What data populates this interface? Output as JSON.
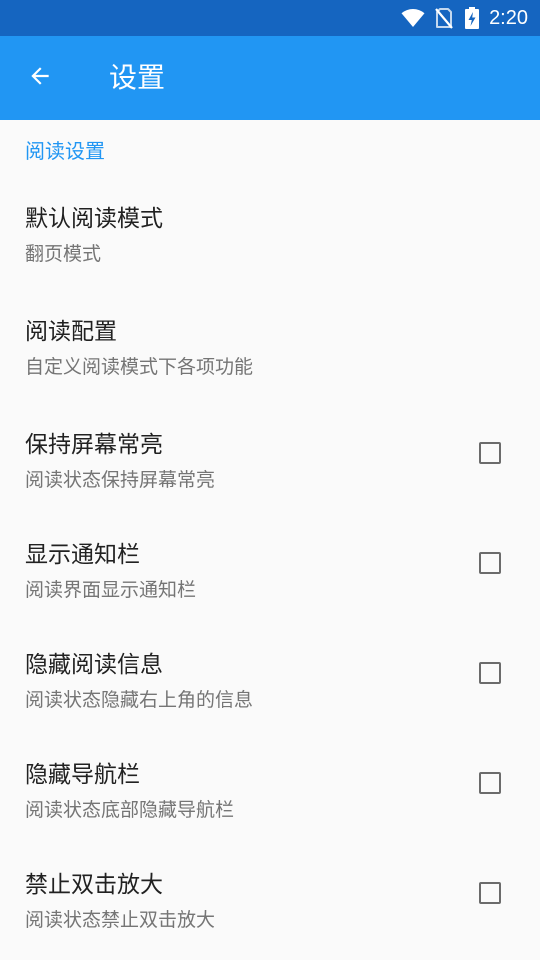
{
  "status_bar": {
    "time": "2:20",
    "icons": [
      "wifi-icon",
      "no-sim-icon",
      "battery-charging-icon"
    ]
  },
  "toolbar": {
    "back_icon": "arrow-left-icon",
    "title": "设置"
  },
  "section": {
    "title": "阅读设置"
  },
  "preferences": [
    {
      "title": "默认阅读模式",
      "summary": "翻页模式",
      "has_checkbox": false
    },
    {
      "title": "阅读配置",
      "summary": "自定义阅读模式下各项功能",
      "has_checkbox": false
    },
    {
      "title": "保持屏幕常亮",
      "summary": "阅读状态保持屏幕常亮",
      "has_checkbox": true,
      "checked": false
    },
    {
      "title": "显示通知栏",
      "summary": "阅读界面显示通知栏",
      "has_checkbox": true,
      "checked": false
    },
    {
      "title": "隐藏阅读信息",
      "summary": "阅读状态隐藏右上角的信息",
      "has_checkbox": true,
      "checked": false
    },
    {
      "title": "隐藏导航栏",
      "summary": "阅读状态底部隐藏导航栏",
      "has_checkbox": true,
      "checked": false
    },
    {
      "title": "禁止双击放大",
      "summary": "阅读状态禁止双击放大",
      "has_checkbox": true,
      "checked": false
    }
  ],
  "colors": {
    "status_bar": "#1565c0",
    "toolbar": "#2196f3",
    "accent": "#2196f3",
    "background": "#fafafa",
    "title_text": "#212121",
    "summary_text": "#757575"
  }
}
